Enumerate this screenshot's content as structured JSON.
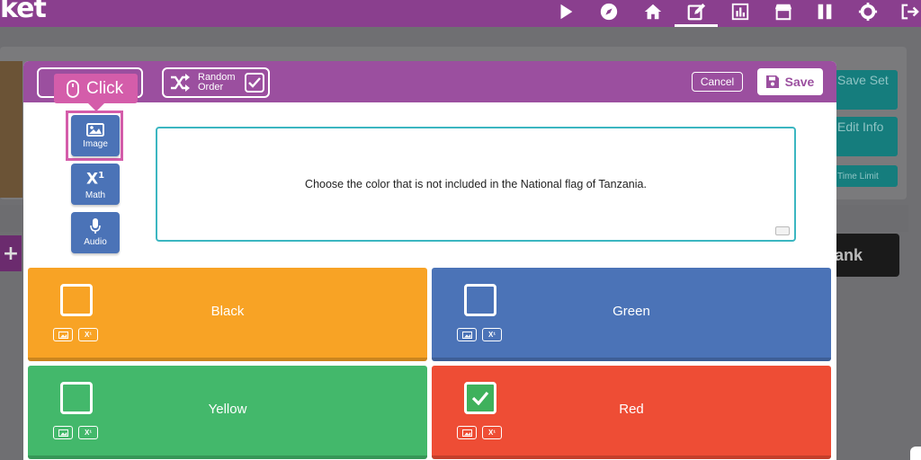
{
  "app": {
    "logo_text": "ket"
  },
  "nav": {
    "icons": [
      "play-icon",
      "compass-icon",
      "home-icon",
      "edit-icon",
      "chart-icon",
      "store-icon",
      "grid-icon",
      "gear-icon",
      "logout-icon"
    ],
    "active": "edit-icon"
  },
  "background": {
    "buttons": [
      "Save Set",
      "Edit Info",
      "Time Limit"
    ],
    "dark_button": "ank"
  },
  "modal": {
    "random_order_label": "Random Order",
    "cancel_label": "Cancel",
    "save_label": "Save",
    "tooltip_label": "Click",
    "media": {
      "image": "Image",
      "math": "Math",
      "audio": "Audio"
    },
    "question_text": "Choose the color that is not included in the National flag of Tanzania.",
    "answers": [
      {
        "label": "Black",
        "color": "#f8a325",
        "correct": false
      },
      {
        "label": "Green",
        "color": "#4b73b7",
        "correct": false
      },
      {
        "label": "Yellow",
        "color": "#43b86b",
        "correct": false
      },
      {
        "label": "Red",
        "color": "#ee4d35",
        "correct": true
      }
    ]
  },
  "colors": {
    "nav": "#8a3f8e",
    "modal_header": "#9b4f9f",
    "highlight": "#d45daa",
    "question_border": "#3bb6c1"
  }
}
